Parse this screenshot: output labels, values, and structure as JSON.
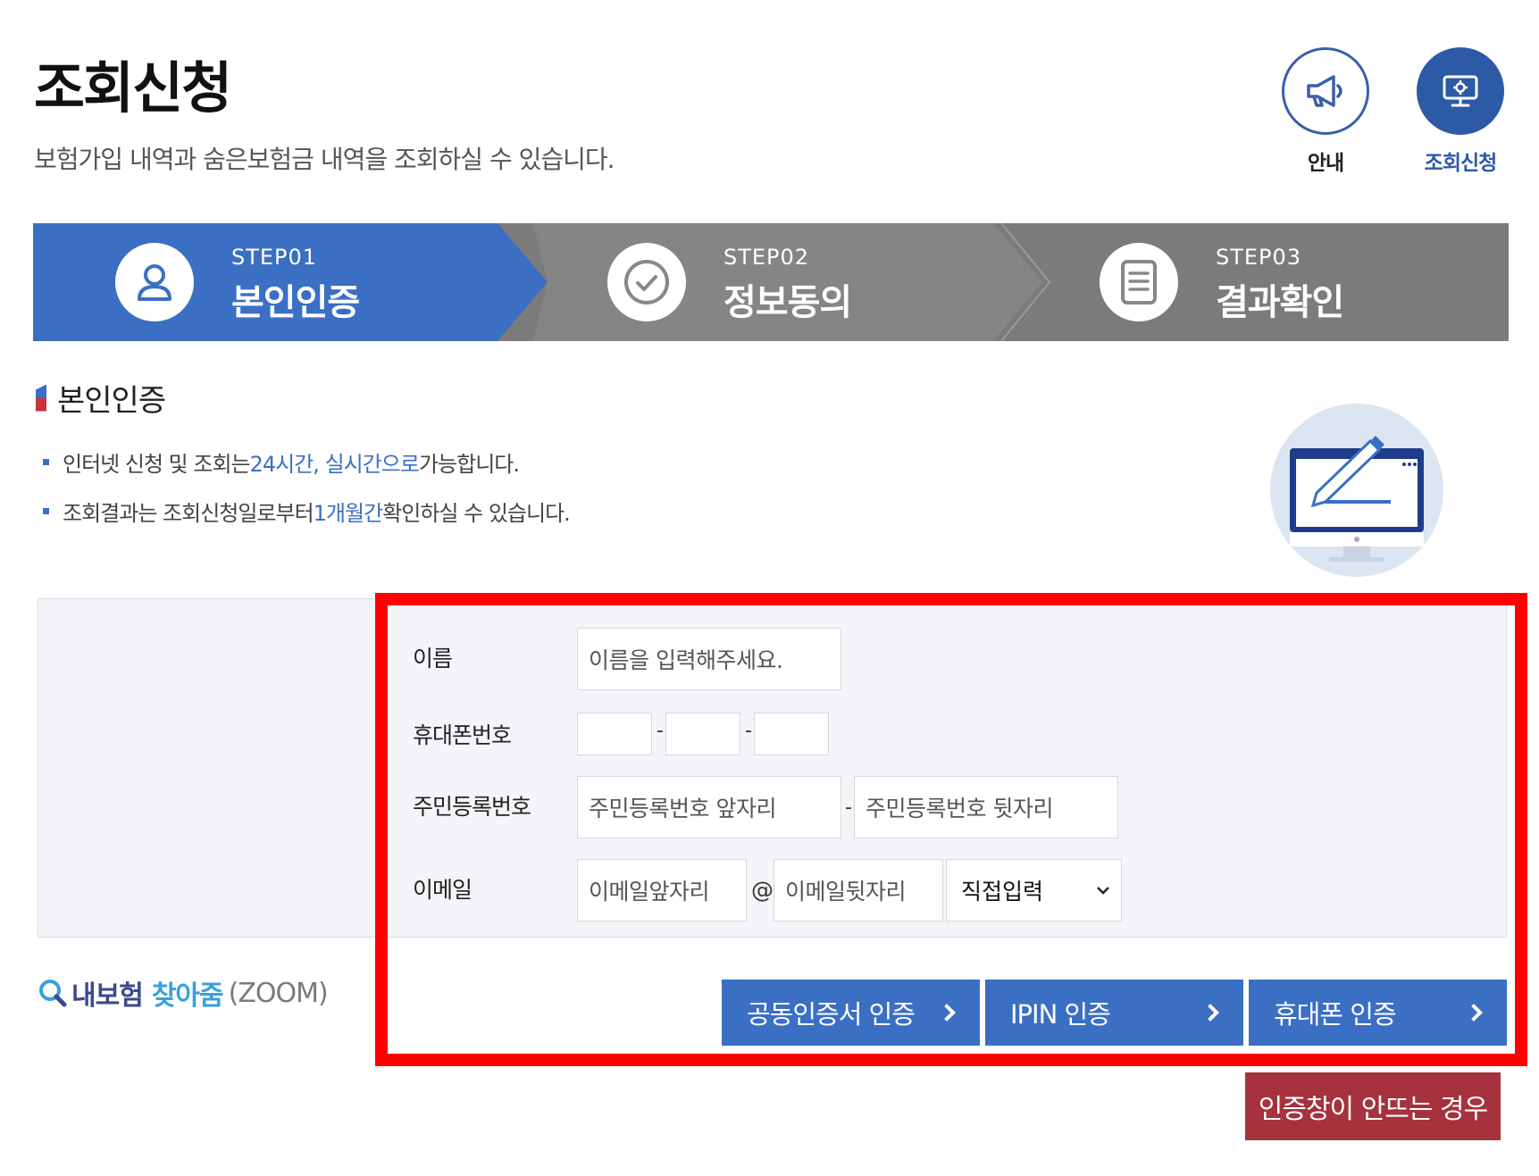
{
  "header": {
    "title": "조회신청",
    "subtitle": "보험가입 내역과 숨은보험금 내역을 조회하실 수 있습니다."
  },
  "top_nav": {
    "guide_label": "안내",
    "apply_label": "조회신청"
  },
  "steps": [
    {
      "num": "STEP01",
      "name": "본인인증",
      "icon": "user-icon",
      "active": true
    },
    {
      "num": "STEP02",
      "name": "정보동의",
      "icon": "check-circle-icon",
      "active": false
    },
    {
      "num": "STEP03",
      "name": "결과확인",
      "icon": "document-icon",
      "active": false
    }
  ],
  "section": {
    "title": "본인인증",
    "bullet1": {
      "pre": "인터넷 신청 및 조회는 ",
      "hl": "24시간, 실시간으로",
      "post": " 가능합니다."
    },
    "bullet2": {
      "pre": "조회결과는 조회신청일로부터 ",
      "hl": "1개월간",
      "post": " 확인하실 수 있습니다."
    }
  },
  "form": {
    "name": {
      "label": "이름",
      "placeholder": "이름을 입력해주세요."
    },
    "phone": {
      "label": "휴대폰번호",
      "sep": "-"
    },
    "rrn": {
      "label": "주민등록번호",
      "front_placeholder": "주민등록번호 앞자리",
      "back_placeholder": "주민등록번호 뒷자리",
      "sep": "-"
    },
    "email": {
      "label": "이메일",
      "local_placeholder": "이메일앞자리",
      "at": "@",
      "domain_placeholder": "이메일뒷자리",
      "select_value": "직접입력"
    }
  },
  "logo": {
    "part1": "내보험",
    "part2": "찾아줌",
    "part3": "(ZOOM)"
  },
  "buttons": {
    "cert": "공동인증서 인증",
    "ipin": "IPIN 인증",
    "phone": "휴대폰 인증",
    "fail": "인증창이 안뜨는 경우"
  },
  "colors": {
    "primary": "#3b6fc4",
    "step_gray": "#858585",
    "alert_red": "#a5323c",
    "highlight": "#ff0000"
  }
}
